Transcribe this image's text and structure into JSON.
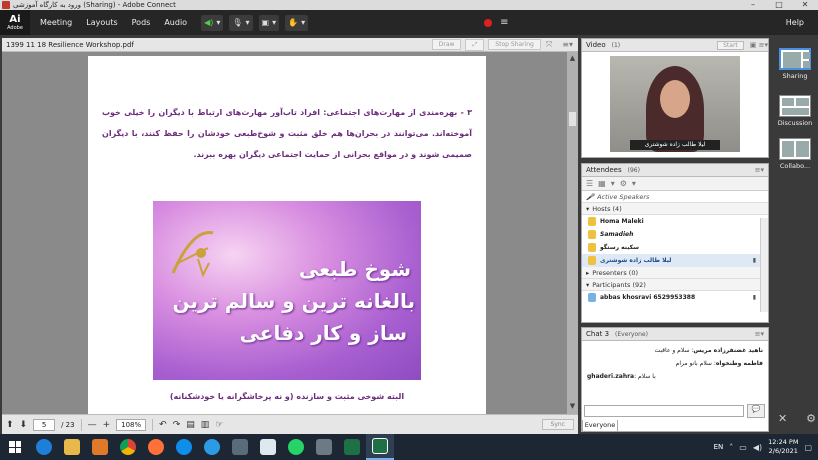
{
  "window": {
    "title": "ورود به کارگاه آموزشی (Sharing) - Adobe Connect",
    "logo_top": "Ai",
    "logo_bottom": "Adobe"
  },
  "menu": {
    "items": [
      "Meeting",
      "Layouts",
      "Pods",
      "Audio"
    ],
    "help": "Help"
  },
  "content_pod": {
    "title": "1399 11 18 Resilience Workshop.pdf",
    "draw_label": "Draw",
    "stop_sharing_label": "Stop Sharing"
  },
  "document": {
    "paragraph": "۳ - بهره‌مندی از مهارت‌های اجتماعی: افراد تاب‌آور مهارت‌های ارتباط با دیگران را خیلی خوب آموخته‌اند. می‌توانند در بحران‌ها هم خلق مثبت و شوخ‌طبعی خودشان را حفظ کنند، با دیگران صمیمی شوند و در مواقع بحرانی از حمایت اجتماعی دیگران بهره ببرند.",
    "image_line1": "شوخ طبعی",
    "image_line2": "بالغانه ترین و سالم ترین",
    "image_line3": "ساز و کار دفاعی",
    "caption": "البته شوخی مثبت و سازنده (و نه پرخاشگرانه یا خودشکنانه)"
  },
  "pager": {
    "current_page": "5",
    "total_pages": "/ 23",
    "zoom": "108%",
    "sync_label": "Sync"
  },
  "video_pod": {
    "title": "Video",
    "count": "(1)",
    "start_label": "Start",
    "speaker_name": "لیلا طالب زاده شوشتری"
  },
  "attendees": {
    "title": "Attendees",
    "count": "(96)",
    "active_speakers": "Active Speakers",
    "hosts_label": "Hosts (4)",
    "hosts": [
      "Homa Maleki",
      "Samadieh",
      "سکینه رستگو",
      "لیلا طالب زاده شوشتری"
    ],
    "presenters_label": "Presenters (0)",
    "participants_label": "Participants (92)",
    "participants": [
      "abbas khosravi 6529953388"
    ]
  },
  "chat": {
    "title": "Chat 3",
    "scope": "(Everyone)",
    "messages": [
      {
        "sender": "ناهید غضنفرزاده مریس",
        "text": "سلام و عاقبت"
      },
      {
        "sender": "فاطمه وطنخواه",
        "text": "سلام بانو مرام"
      },
      {
        "sender": "ghaderi.zahra",
        "text": "با سلام"
      }
    ],
    "tab_label": "Everyone"
  },
  "layouts": [
    "Sharing",
    "Discussion",
    "Collabo..."
  ],
  "taskbar": {
    "lang": "EN",
    "time": "12:24 PM",
    "date": "2/6/2021"
  }
}
